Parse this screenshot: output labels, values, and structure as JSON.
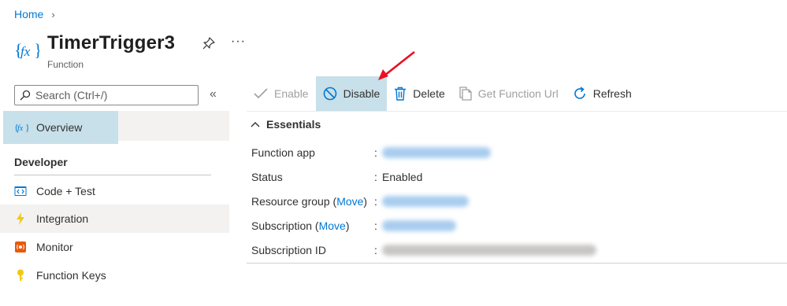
{
  "breadcrumb": {
    "home": "Home",
    "separator": "›"
  },
  "header": {
    "title": "TimerTrigger3",
    "subtitle": "Function",
    "more": "···"
  },
  "sidebar": {
    "search_placeholder": "Search (Ctrl+/)",
    "collapse": "«",
    "overview": "Overview",
    "section": "Developer",
    "items": [
      {
        "label": "Code + Test",
        "icon": "code-test-icon"
      },
      {
        "label": "Integration",
        "icon": "lightning-icon"
      },
      {
        "label": "Monitor",
        "icon": "monitor-icon"
      },
      {
        "label": "Function Keys",
        "icon": "key-icon"
      }
    ]
  },
  "toolbar": {
    "enable": "Enable",
    "disable": "Disable",
    "delete": "Delete",
    "get_url": "Get Function Url",
    "refresh": "Refresh"
  },
  "essentials": {
    "title": "Essentials",
    "function_app_label": "Function app",
    "status_label": "Status",
    "status_value": "Enabled",
    "resource_group_label": "Resource group",
    "subscription_label": "Subscription",
    "subscription_id_label": "Subscription ID",
    "move": "Move",
    "open_paren": " (",
    "close_paren": ")",
    "colon": ":"
  },
  "colors": {
    "accent": "#0078d4",
    "selected": "#c7e0e9",
    "arrow": "#e81123"
  }
}
